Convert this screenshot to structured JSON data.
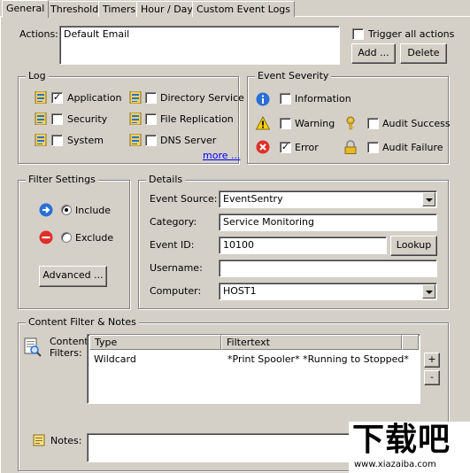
{
  "tabs": [
    "General",
    "Threshold",
    "Timers",
    "Hour / Day",
    "Custom Event Logs"
  ],
  "actions": {
    "label": "Actions:",
    "value": "Default Email",
    "trigger_all_label": "Trigger all actions",
    "trigger_all_checked": false,
    "add_label": "Add ...",
    "delete_label": "Delete"
  },
  "log": {
    "title": "Log",
    "items": [
      {
        "label": "Application",
        "checked": true
      },
      {
        "label": "Security",
        "checked": false
      },
      {
        "label": "System",
        "checked": false
      },
      {
        "label": "Directory Service",
        "checked": false
      },
      {
        "label": "File Replication",
        "checked": false
      },
      {
        "label": "DNS Server",
        "checked": false
      }
    ],
    "more_label": "more ..."
  },
  "severity": {
    "title": "Event Severity",
    "items": [
      {
        "label": "Information",
        "checked": false,
        "icon": "info-icon"
      },
      {
        "label": "Warning",
        "checked": false,
        "icon": "warning-icon"
      },
      {
        "label": "Error",
        "checked": true,
        "icon": "error-icon"
      },
      {
        "label": "Audit Success",
        "checked": false,
        "icon": "key-icon"
      },
      {
        "label": "Audit Failure",
        "checked": false,
        "icon": "lock-icon"
      }
    ]
  },
  "filter": {
    "title": "Filter Settings",
    "include_label": "Include",
    "exclude_label": "Exclude",
    "selected": "Include",
    "advanced_label": "Advanced ..."
  },
  "details": {
    "title": "Details",
    "event_source_label": "Event Source:",
    "event_source_value": "EventSentry",
    "category_label": "Category:",
    "category_value": "Service Monitoring",
    "event_id_label": "Event ID:",
    "event_id_value": "10100",
    "lookup_label": "Lookup",
    "username_label": "Username:",
    "username_value": "",
    "computer_label": "Computer:",
    "computer_value": "HOST1"
  },
  "content": {
    "title": "Content Filter & Notes",
    "filters_label_line1": "Content",
    "filters_label_line2": "Filters:",
    "columns": [
      "Type",
      "Filtertext"
    ],
    "rows": [
      {
        "type": "Wildcard",
        "filtertext": "*Print Spooler* *Running to Stopped*"
      }
    ],
    "plus_label": "+",
    "minus_label": "-",
    "notes_label": "Notes:",
    "notes_value": ""
  },
  "watermark": {
    "logo": "下载吧",
    "url": "www.xiazaiba.com"
  },
  "colors": {
    "link": "#0000ff",
    "face": "#d4d0c8",
    "error": "#e0302a",
    "info": "#2a6fd6"
  }
}
